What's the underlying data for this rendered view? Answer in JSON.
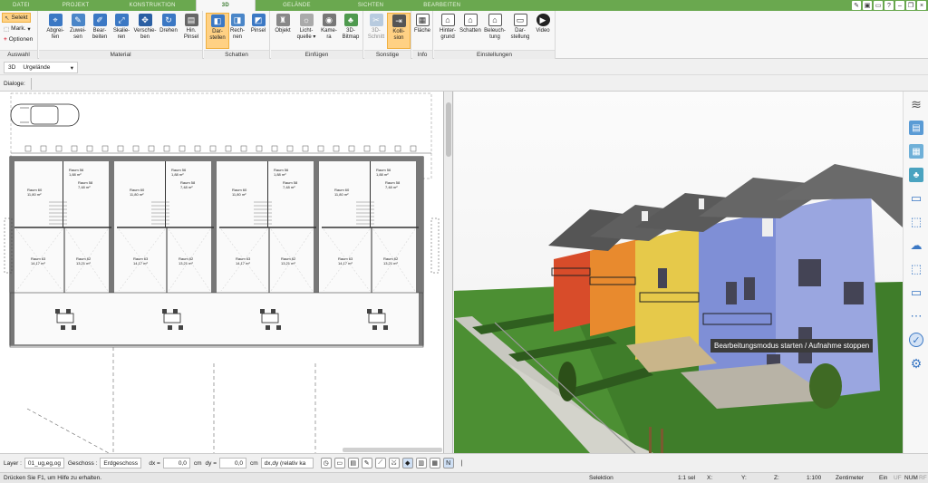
{
  "tabs": [
    "DATEI",
    "PROJEKT",
    "KONSTRUKTION",
    "3D",
    "GELÄNDE",
    "SICHTEN",
    "BEARBEITEN"
  ],
  "active_tab": "3D",
  "auswahl": {
    "selekt": "Selekt",
    "mark": "Mark.",
    "optionen": "Optionen",
    "label": "Auswahl"
  },
  "material": {
    "label": "Material",
    "buttons": [
      "Abgrei-\nfen",
      "Zuwei-\nsen",
      "Bear-\nbeiten",
      "Skalie-\nren",
      "Verschie-\nben",
      "Drehen",
      "Hin.\nPinsel"
    ]
  },
  "schatten": {
    "label": "Schatten",
    "buttons": [
      "Dar-\nstellen",
      "Rech-\nnen",
      "Pinsel"
    ]
  },
  "einfuegen": {
    "label": "Einfügen",
    "buttons": [
      "Objekt",
      "Licht-\nquelle ▾",
      "Kame-\nra",
      "3D-\nBitmap"
    ]
  },
  "sonstige": {
    "label": "Sonstige",
    "buttons": [
      "3D-\nSchnitt",
      "Kolli-\nsion"
    ]
  },
  "info": {
    "label": "Info",
    "buttons": [
      "Fläche"
    ]
  },
  "einstellungen": {
    "label": "Einstellungen",
    "buttons": [
      "Hinter-\ngrund",
      "Schatten",
      "Beleuch-\ntung",
      "Dar-\nstellung",
      "Video"
    ]
  },
  "view_mode": "3D",
  "view_select": "Urgelände",
  "dialoge": "Dialoge:",
  "rooms": [
    {
      "name": "Raum 56",
      "area": "1,88 m²"
    },
    {
      "name": "Raum 58",
      "area": "7,48 m²"
    },
    {
      "name": "Raum 60",
      "area": "11,80 m²"
    },
    {
      "name": "Raum 63",
      "area": "14,17 m²"
    },
    {
      "name": "Raum 62",
      "area": "13,21 m²"
    }
  ],
  "tooltip": "Bearbeitungsmodus starten / Aufnahme stoppen",
  "bottom": {
    "layer_label": "Layer :",
    "layer_val": "01_ug,eg,og",
    "geschoss_label": "Geschoss :",
    "geschoss_val": "Erdgeschoss",
    "dx_label": "dx =",
    "dx_val": "0,0",
    "cm1": "cm",
    "dy_label": "dy =",
    "dy_val": "0,0",
    "cm2": "cm",
    "mode_val": "dx,dy (relativ ka"
  },
  "status": {
    "hint": "Drücken Sie F1, um Hilfe zu erhalten.",
    "selektion": "Selektion",
    "sel": "1:1 sel",
    "x": "X:",
    "y": "Y:",
    "z": "Z:",
    "scale": "1:100",
    "unit": "Zentimeter",
    "ein": "Ein",
    "uf": "UF",
    "num": "NUM",
    "rf": "RF"
  },
  "colors": {
    "tabbar": "#6aa84f",
    "active_btn": "#ffd184",
    "blue": "#3b78c4"
  }
}
